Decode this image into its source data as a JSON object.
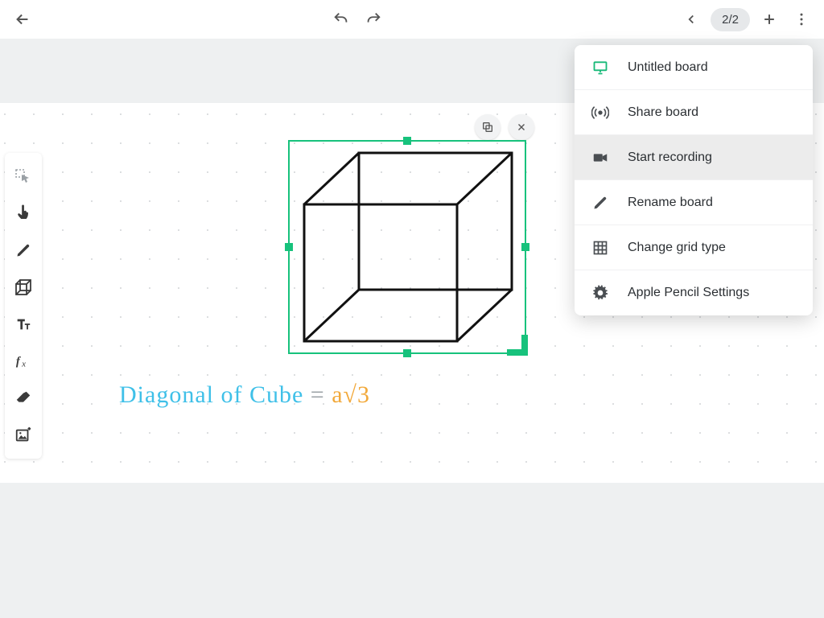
{
  "header": {
    "page_indicator": "2/2"
  },
  "menu": {
    "items": [
      {
        "label": "Untitled board"
      },
      {
        "label": "Share board"
      },
      {
        "label": "Start recording"
      },
      {
        "label": "Rename board"
      },
      {
        "label": "Change grid type"
      },
      {
        "label": "Apple Pencil Settings"
      }
    ]
  },
  "formula": {
    "lhs": "Diagonal of Cube",
    "eq": " = ",
    "rhs": "a√3"
  }
}
